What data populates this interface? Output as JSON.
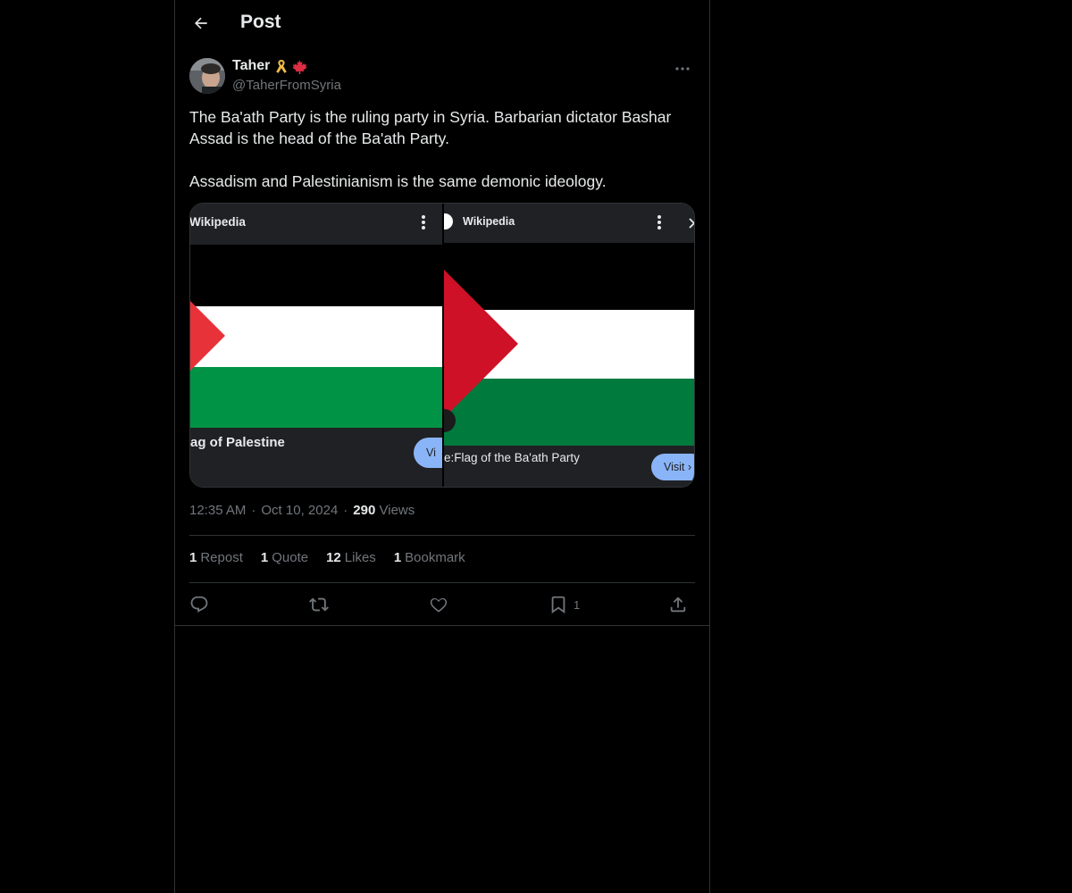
{
  "header": {
    "title": "Post"
  },
  "author": {
    "name": "Taher",
    "handle": "@TaherFromSyria",
    "badges": [
      "ribbon-emoji",
      "maple-leaf-emoji"
    ]
  },
  "post": {
    "text": "The Ba'ath Party is the ruling party in Syria. Barbarian dictator Bashar Assad is the head of the Ba'ath Party.\n\nAssadism and Palestinianism is the same demonic ideology."
  },
  "media": {
    "left": {
      "source": "Wikipedia",
      "caption": "ag of Palestine",
      "button": "Vi"
    },
    "right": {
      "source": "Wikipedia",
      "caption": "e:Flag of the Ba'ath Party",
      "button": "Visit ›"
    }
  },
  "meta": {
    "time": "12:35 AM",
    "separator": "·",
    "date": "Oct 10, 2024",
    "views_count": "290",
    "views_label": "Views"
  },
  "stats": [
    {
      "count": "1",
      "label": "Repost"
    },
    {
      "count": "1",
      "label": "Quote"
    },
    {
      "count": "12",
      "label": "Likes"
    },
    {
      "count": "1",
      "label": "Bookmark"
    }
  ],
  "actions": {
    "bookmark_count": "1"
  },
  "colors": {
    "flag_red_left": "#e8323a",
    "flag_red_right": "#ce1126",
    "flag_green_left": "#009345",
    "flag_green_right": "#007a3d",
    "visit_button": "#8ab4f8"
  }
}
